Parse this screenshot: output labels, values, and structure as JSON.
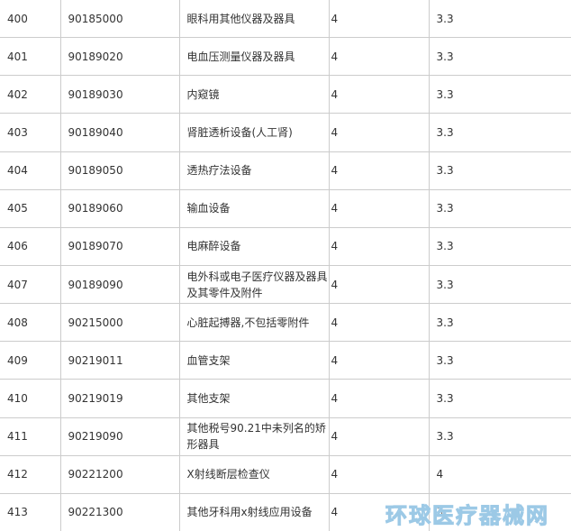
{
  "table": {
    "rows": [
      {
        "no": "400",
        "code": "90185000",
        "name": "眼科用其他仪器及器具",
        "c4": "4",
        "c5": "3.3"
      },
      {
        "no": "401",
        "code": "90189020",
        "name": "电血压测量仪器及器具",
        "c4": "4",
        "c5": "3.3"
      },
      {
        "no": "402",
        "code": "90189030",
        "name": "内窥镜",
        "c4": "4",
        "c5": "3.3"
      },
      {
        "no": "403",
        "code": "90189040",
        "name": "肾脏透析设备(人工肾)",
        "c4": "4",
        "c5": "3.3"
      },
      {
        "no": "404",
        "code": "90189050",
        "name": "透热疗法设备",
        "c4": "4",
        "c5": "3.3"
      },
      {
        "no": "405",
        "code": "90189060",
        "name": "输血设备",
        "c4": "4",
        "c5": "3.3"
      },
      {
        "no": "406",
        "code": "90189070",
        "name": "电麻醉设备",
        "c4": "4",
        "c5": "3.3"
      },
      {
        "no": "407",
        "code": "90189090",
        "name": "电外科或电子医疗仪器及器具及其零件及附件",
        "c4": "4",
        "c5": "3.3"
      },
      {
        "no": "408",
        "code": "90215000",
        "name": "心脏起搏器,不包括零附件",
        "c4": "4",
        "c5": "3.3"
      },
      {
        "no": "409",
        "code": "90219011",
        "name": "血管支架",
        "c4": "4",
        "c5": "3.3"
      },
      {
        "no": "410",
        "code": "90219019",
        "name": "其他支架",
        "c4": "4",
        "c5": "3.3"
      },
      {
        "no": "411",
        "code": "90219090",
        "name": "其他税号90.21中未列名的矫形器具",
        "c4": "4",
        "c5": "3.3"
      },
      {
        "no": "412",
        "code": "90221200",
        "name": "X射线断层检查仪",
        "c4": "4",
        "c5": "4"
      },
      {
        "no": "413",
        "code": "90221300",
        "name": "其他牙科用x射线应用设备",
        "c4": "4",
        "c5": "3"
      }
    ]
  },
  "watermark": {
    "text": "环球医疗器械网"
  }
}
